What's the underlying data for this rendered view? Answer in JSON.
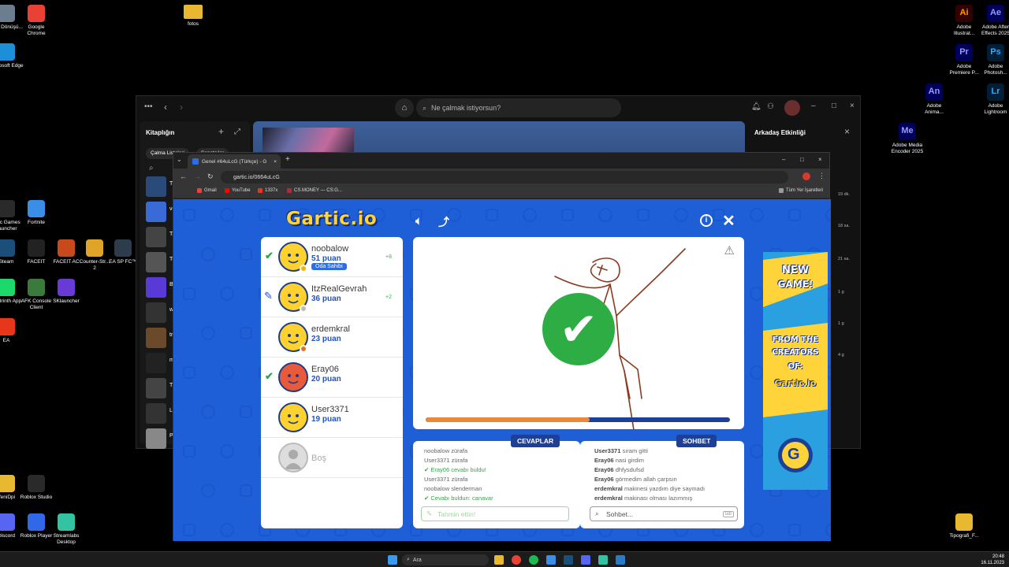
{
  "desktop": {
    "left_icons": [
      {
        "label": "Geri Dönüşü...",
        "color": "#6b7d8f",
        "icon": "recycle-bin-icon"
      },
      {
        "label": "Google Chrome",
        "color": "#e94235",
        "icon": "chrome-icon"
      },
      {
        "label": "Microsoft Edge",
        "color": "#1d8fd8",
        "icon": "edge-icon"
      },
      {
        "label": "Epic Games Launcher",
        "color": "#2a2a2a",
        "icon": "epic-games-icon"
      },
      {
        "label": "Fortnite",
        "color": "#3a8ee6",
        "icon": "fortnite-icon"
      },
      {
        "label": "Steam",
        "color": "#1b4f7a",
        "icon": "steam-icon"
      },
      {
        "label": "FACEIT",
        "color": "#222222",
        "icon": "faceit-icon"
      },
      {
        "label": "FACEIT AC",
        "color": "#c84a1c",
        "icon": "faceit-ac-icon"
      },
      {
        "label": "Counter-Str... 2",
        "color": "#e0a528",
        "icon": "counter-strike-icon"
      },
      {
        "label": "EA SP FC™",
        "color": "#2e3b4c",
        "icon": "ea-fc-icon"
      },
      {
        "label": "Modrinth App",
        "color": "#1bd96a",
        "icon": "modrinth-icon"
      },
      {
        "label": "AFK Console Client",
        "color": "#3a7a3a",
        "icon": "minecraft-icon"
      },
      {
        "label": "SKlauncher",
        "color": "#6a3ad6",
        "icon": "sklauncher-icon"
      },
      {
        "label": "EA",
        "color": "#e8361a",
        "icon": "ea-icon"
      },
      {
        "label": "YeniDpi",
        "color": "#e8b830",
        "icon": "folder-icon"
      },
      {
        "label": "Roblox Studio",
        "color": "#2a2a2a",
        "icon": "roblox-studio-icon"
      },
      {
        "label": "Discord",
        "color": "#5865f2",
        "icon": "discord-icon"
      },
      {
        "label": "Roblox Player",
        "color": "#3068e8",
        "icon": "roblox-player-icon"
      },
      {
        "label": "Streamlabs Desktop",
        "color": "#31c3a2",
        "icon": "streamlabs-icon"
      }
    ],
    "fotos_label": "fotos",
    "right_icons": [
      {
        "label": "Adobe Illustrat...",
        "abbr": "Ai",
        "color": "#330000",
        "fg": "#ff9a00"
      },
      {
        "label": "Adobe After Effects 2025",
        "abbr": "Ae",
        "color": "#00005b",
        "fg": "#9999ff"
      },
      {
        "label": "Adobe Premiere P...",
        "abbr": "Pr",
        "color": "#00005b",
        "fg": "#9999ff"
      },
      {
        "label": "Adobe Photosh...",
        "abbr": "Ps",
        "color": "#001e36",
        "fg": "#31a8ff"
      },
      {
        "label": "Adobe Anima...",
        "abbr": "An",
        "color": "#00005b",
        "fg": "#9999ff"
      },
      {
        "label": "Adobe Lightroom",
        "abbr": "Lr",
        "color": "#001e36",
        "fg": "#31a8ff"
      },
      {
        "label": "Adobe Media Encoder 2025",
        "abbr": "Me",
        "color": "#00005b",
        "fg": "#9999ff"
      },
      {
        "label": "Tipografi_F...",
        "abbr": "",
        "color": "#e8b830",
        "fg": "#e8b830"
      }
    ]
  },
  "spotify": {
    "search_placeholder": "Ne çalmak istiyorsun?",
    "library_title": "Kitaplığın",
    "pill_playlists": "Çalma Listeleri",
    "pill_artists": "Sanatçılar",
    "friends_title": "Arkadaş Etkinliği",
    "side_letters": [
      "Tl",
      "vo",
      "Ta",
      "Te",
      "Be",
      "w",
      "tr",
      "m",
      "Th",
      "La",
      "P"
    ],
    "right_texts": [
      "19 dk.",
      "18 sa.",
      "21 sa.",
      "1 g",
      "1 g",
      "4 g"
    ]
  },
  "chrome": {
    "tab_title": "Genel #64uLcG (Türkçe) - G",
    "url": "gartic.io/0664uLcG",
    "bookmarks": [
      "Gmail",
      "YouTube",
      "1337x",
      "CS.MONEY — CS:G...",
      "Tüm Yer İşaretleri"
    ]
  },
  "gartic": {
    "logo": "Gartic.io",
    "players": [
      {
        "name": "noobalow",
        "score": "51 puan",
        "gain": "+8",
        "status": "check",
        "badge": "Oda Sahibi",
        "avatar": "#ffd230",
        "dot": "#f5b400"
      },
      {
        "name": "ItzRealGevrah",
        "score": "36 puan",
        "gain": "+2",
        "status": "drawing",
        "badge": "",
        "avatar": "#ffd230",
        "dot": "#bbbbbb"
      },
      {
        "name": "erdemkral",
        "score": "23 puan",
        "gain": "",
        "status": "",
        "badge": "",
        "avatar": "#ffd230",
        "dot": "#e8711b"
      },
      {
        "name": "Eray06",
        "score": "20 puan",
        "gain": "",
        "status": "check",
        "badge": "",
        "avatar": "#e85a3a",
        "dot": ""
      },
      {
        "name": "User3371",
        "score": "19 puan",
        "gain": "",
        "status": "",
        "badge": "",
        "avatar": "#ffd230",
        "dot": ""
      },
      {
        "name": "Boş",
        "score": "",
        "gain": "",
        "status": "",
        "badge": "",
        "avatar": "#dddddd",
        "dot": ""
      }
    ],
    "progress": 0.54,
    "answers_tab": "CEVAPLAR",
    "chat_tab": "SOHBET",
    "answers": [
      {
        "user": "noobalow",
        "text": "zürafa",
        "ok": false
      },
      {
        "user": "User3371",
        "text": "zürafa",
        "ok": false
      },
      {
        "user": "Eray06",
        "text": "cevabı buldu!",
        "ok": true
      },
      {
        "user": "User3371",
        "text": "zürafa",
        "ok": false
      },
      {
        "user": "noobalow",
        "text": "slenderman",
        "ok": false
      },
      {
        "user": "Cevabı buldun:",
        "text": "canavar",
        "ok": true
      }
    ],
    "chat": [
      {
        "user": "User3371",
        "text": "sıram gitti"
      },
      {
        "user": "Eray06",
        "text": "nasi girdim"
      },
      {
        "user": "Eray06",
        "text": "dhfysdufsd"
      },
      {
        "user": "Eray06",
        "text": "görmedim allah çarpsın"
      },
      {
        "user": "erdemkral",
        "text": "makinesi yazdım diye saymadı"
      },
      {
        "user": "erdemkral",
        "text": "makinası olması lazımmış"
      }
    ],
    "answer_input": "Tahmin ettin!",
    "chat_input": "Sohbet...",
    "tab_key": "tab",
    "ad_texts": [
      "NEW",
      "GAME!",
      "FROM THE",
      "CREATORS",
      "OF:",
      "Gartic.io"
    ]
  },
  "taskbar": {
    "search": "Ara",
    "time": "20:48",
    "date": "16.11.2023"
  }
}
